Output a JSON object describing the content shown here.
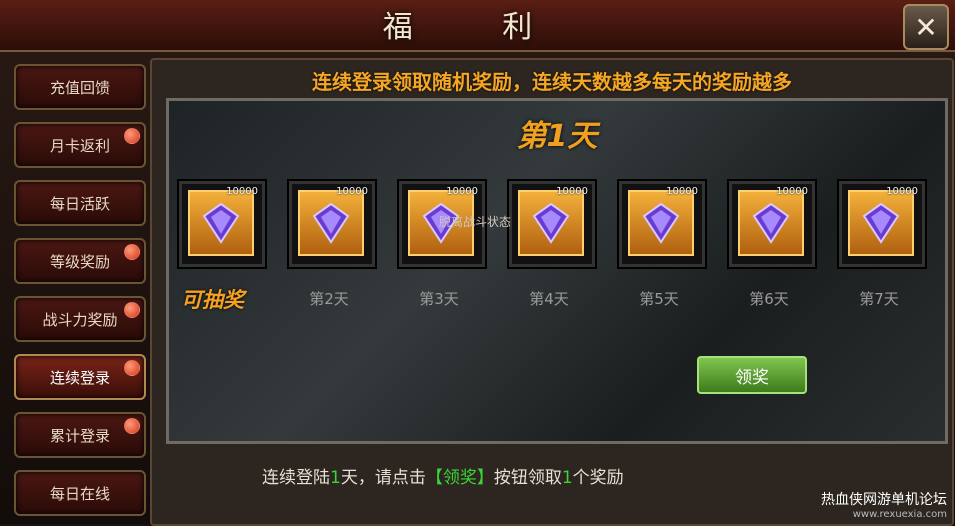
{
  "window": {
    "title": "福 利",
    "close_icon": "close-icon"
  },
  "sidebar": {
    "items": [
      {
        "label": "充值回馈",
        "badge": false
      },
      {
        "label": "月卡返利",
        "badge": true
      },
      {
        "label": "每日活跃",
        "badge": false
      },
      {
        "label": "等级奖励",
        "badge": true
      },
      {
        "label": "战斗力奖励",
        "badge": true
      },
      {
        "label": "连续登录",
        "badge": true,
        "active": true
      },
      {
        "label": "累计登录",
        "badge": true
      },
      {
        "label": "每日在线",
        "badge": false
      }
    ]
  },
  "main": {
    "headline": "连续登录领取随机奖励，连续天数越多每天的奖励越多",
    "day_title": "第1天",
    "overlay_text": "脱离战斗状态",
    "claimable_label": "可抽奖",
    "rewards": [
      {
        "qty": "10000",
        "label": ""
      },
      {
        "qty": "10000",
        "label": "第2天"
      },
      {
        "qty": "10000",
        "label": "第3天"
      },
      {
        "qty": "10000",
        "label": "第4天"
      },
      {
        "qty": "10000",
        "label": "第5天"
      },
      {
        "qty": "10000",
        "label": "第6天"
      },
      {
        "qty": "10000",
        "label": "第7天"
      }
    ],
    "claim_button": "领奖",
    "footer": {
      "prefix": "连续登陆",
      "days": "1",
      "mid": "天，请点击",
      "button_ref": "【领奖】",
      "suffix1": "按钮领取",
      "count": "1",
      "suffix2": "个奖励"
    }
  },
  "watermark": {
    "line1": "热血侠网游单机论坛",
    "line2": "www.rexuexia.com"
  }
}
